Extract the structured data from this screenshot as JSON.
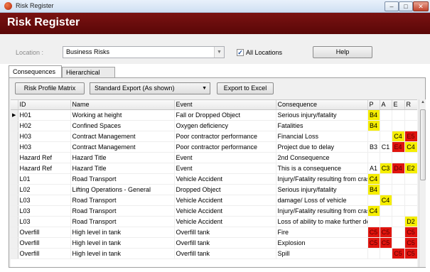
{
  "window": {
    "title": "Risk Register"
  },
  "header": {
    "title": "Risk Register"
  },
  "toolbar": {
    "location_label": "Location :",
    "location_value": "Business Risks",
    "all_locations_label": "All Locations",
    "all_locations_checked": "✓",
    "help_label": "Help"
  },
  "tabs": [
    {
      "label": "Consequences",
      "active": true
    },
    {
      "label": "Hierarchical",
      "active": false
    }
  ],
  "actions": {
    "profile_label": "Risk Profile Matrix",
    "export_value": "Standard Export (As shown)",
    "excel_label": "Export to Excel"
  },
  "colors": {
    "yellow": "#f6ee00",
    "red": "#e0140e",
    "header_bar": "#6b0d0d"
  },
  "columns": {
    "id": "ID",
    "name": "Name",
    "event": "Event",
    "consequence": "Consequence",
    "p": "P",
    "a": "A",
    "e": "E",
    "r": "R"
  },
  "rows": [
    {
      "marker": "▶",
      "id": "H01",
      "name": "Working at height",
      "event": "Fall or Dropped Object",
      "consequence": "Serious injury/fatality",
      "p": {
        "v": "B4",
        "c": "y"
      },
      "a": {
        "v": "",
        "c": "n"
      },
      "e": {
        "v": "",
        "c": "n"
      },
      "r": {
        "v": "",
        "c": "n"
      }
    },
    {
      "marker": "",
      "id": "H02",
      "name": "Confined Spaces",
      "event": "Oxygen deficiency",
      "consequence": "Fatalities",
      "p": {
        "v": "B4",
        "c": "y"
      },
      "a": {
        "v": "",
        "c": "n"
      },
      "e": {
        "v": "",
        "c": "n"
      },
      "r": {
        "v": "",
        "c": "n"
      }
    },
    {
      "marker": "",
      "id": "H03",
      "name": "Contract Management",
      "event": "Poor contractor performance",
      "consequence": "Financial Loss",
      "p": {
        "v": "",
        "c": "n"
      },
      "a": {
        "v": "",
        "c": "n"
      },
      "e": {
        "v": "C4",
        "c": "y"
      },
      "r": {
        "v": "E5",
        "c": "r"
      }
    },
    {
      "marker": "",
      "id": "H03",
      "name": "Contract Management",
      "event": "Poor contractor performance",
      "consequence": "Project due to delay",
      "p": {
        "v": "B3",
        "c": "n"
      },
      "a": {
        "v": "C1",
        "c": "n"
      },
      "e": {
        "v": "E4",
        "c": "r"
      },
      "r": {
        "v": "C4",
        "c": "y"
      }
    },
    {
      "marker": "",
      "id": "Hazard Ref",
      "name": "Hazard Title",
      "event": "Event",
      "consequence": "2nd Consequence",
      "p": {
        "v": "",
        "c": "n"
      },
      "a": {
        "v": "",
        "c": "n"
      },
      "e": {
        "v": "",
        "c": "n"
      },
      "r": {
        "v": "",
        "c": "n"
      }
    },
    {
      "marker": "",
      "id": "Hazard Ref",
      "name": "Hazard Title",
      "event": "Event",
      "consequence": "This is a consequence",
      "p": {
        "v": "A1",
        "c": "n"
      },
      "a": {
        "v": "C3",
        "c": "y"
      },
      "e": {
        "v": "D4",
        "c": "r"
      },
      "r": {
        "v": "E2",
        "c": "y"
      }
    },
    {
      "marker": "",
      "id": "L01",
      "name": "Road Transport",
      "event": "Vehicle Accident",
      "consequence": "Injury/Fatality resulting from crash",
      "p": {
        "v": "C4",
        "c": "y"
      },
      "a": {
        "v": "",
        "c": "n"
      },
      "e": {
        "v": "",
        "c": "n"
      },
      "r": {
        "v": "",
        "c": "n"
      }
    },
    {
      "marker": "",
      "id": "L02",
      "name": "Lifting Operations - General",
      "event": "Dropped Object",
      "consequence": "Serious injury/fatality",
      "p": {
        "v": "B4",
        "c": "y"
      },
      "a": {
        "v": "",
        "c": "n"
      },
      "e": {
        "v": "",
        "c": "n"
      },
      "r": {
        "v": "",
        "c": "n"
      }
    },
    {
      "marker": "",
      "id": "L03",
      "name": "Road Transport",
      "event": "Vehicle Accident",
      "consequence": "damage/ Loss of vehicle",
      "p": {
        "v": "",
        "c": "n"
      },
      "a": {
        "v": "C4",
        "c": "y"
      },
      "e": {
        "v": "",
        "c": "n"
      },
      "r": {
        "v": "",
        "c": "n"
      }
    },
    {
      "marker": "",
      "id": "L03",
      "name": "Road Transport",
      "event": "Vehicle Accident",
      "consequence": "Injury/Fatality resulting from crash",
      "p": {
        "v": "C4",
        "c": "y"
      },
      "a": {
        "v": "",
        "c": "n"
      },
      "e": {
        "v": "",
        "c": "n"
      },
      "r": {
        "v": "",
        "c": "n"
      }
    },
    {
      "marker": "",
      "id": "L03",
      "name": "Road Transport",
      "event": "Vehicle Accident",
      "consequence": "Loss of ability to make further deli",
      "p": {
        "v": "",
        "c": "n"
      },
      "a": {
        "v": "",
        "c": "n"
      },
      "e": {
        "v": "",
        "c": "n"
      },
      "r": {
        "v": "D2",
        "c": "y"
      }
    },
    {
      "marker": "",
      "id": "Overfill",
      "name": "High level in tank",
      "event": "Overfill tank",
      "consequence": "Fire",
      "p": {
        "v": "C5",
        "c": "r"
      },
      "a": {
        "v": "C5",
        "c": "r"
      },
      "e": {
        "v": "",
        "c": "n"
      },
      "r": {
        "v": "C5",
        "c": "r"
      }
    },
    {
      "marker": "",
      "id": "Overfill",
      "name": "High level in tank",
      "event": "Overfill tank",
      "consequence": "Explosion",
      "p": {
        "v": "C5",
        "c": "r"
      },
      "a": {
        "v": "C5",
        "c": "r"
      },
      "e": {
        "v": "",
        "c": "n"
      },
      "r": {
        "v": "C5",
        "c": "r"
      }
    },
    {
      "marker": "",
      "id": "Overfill",
      "name": "High level in tank",
      "event": "Overfill tank",
      "consequence": "Spill",
      "p": {
        "v": "",
        "c": "n"
      },
      "a": {
        "v": "",
        "c": "n"
      },
      "e": {
        "v": "C5",
        "c": "r"
      },
      "r": {
        "v": "C5",
        "c": "r"
      }
    }
  ]
}
